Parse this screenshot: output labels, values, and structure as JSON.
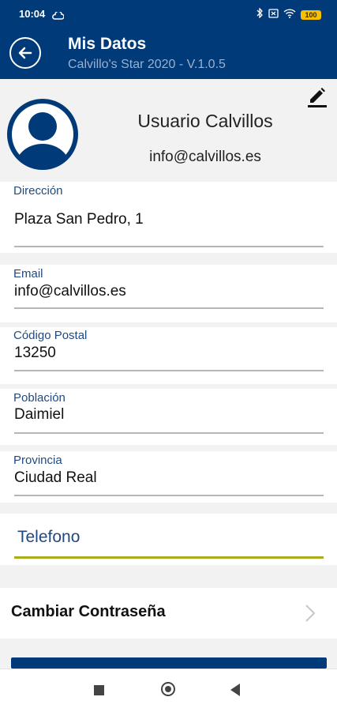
{
  "status_bar": {
    "time": "10:04",
    "battery": "100"
  },
  "app_bar": {
    "title": "Mis Datos",
    "subtitle": "Calvillo's Star 2020 - V.1.0.5"
  },
  "profile": {
    "name": "Usuario Calvillos",
    "email": "info@calvillos.es"
  },
  "fields": [
    {
      "label": "Dirección",
      "value": "Plaza San Pedro, 1"
    },
    {
      "label": "Email",
      "value": "info@calvillos.es"
    },
    {
      "label": "Código Postal",
      "value": "13250"
    },
    {
      "label": "Población",
      "value": "Daimiel"
    },
    {
      "label": "Provincia",
      "value": "Ciudad Real"
    }
  ],
  "telefono": {
    "placeholder": "Telefono"
  },
  "password": {
    "label": "Cambiar Contraseña"
  },
  "colors": {
    "brand": "#003a78",
    "accent_line": "#a9ac1c",
    "label": "#1f4a80"
  }
}
